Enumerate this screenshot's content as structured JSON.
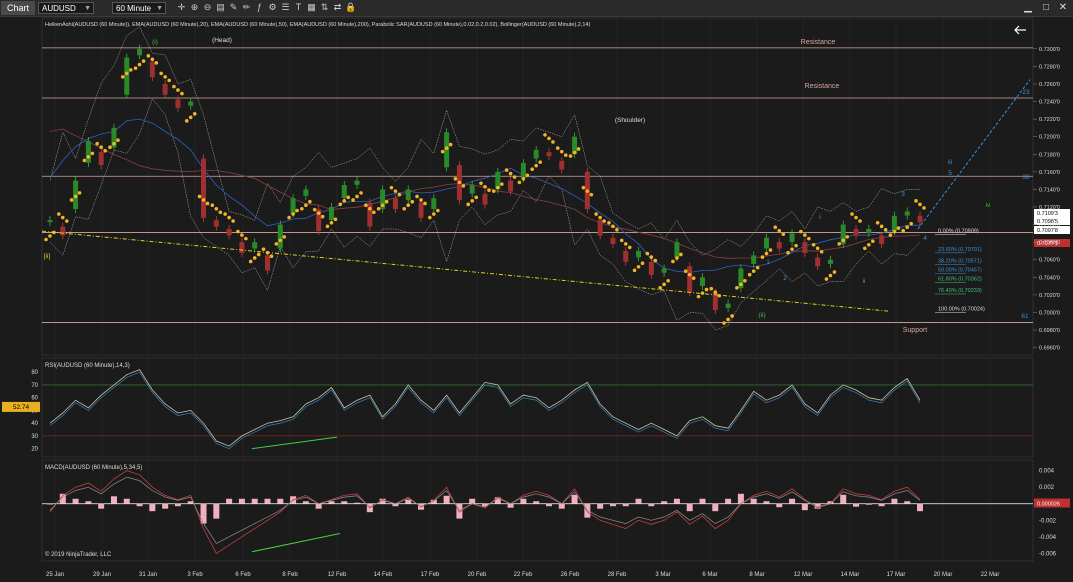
{
  "toolbar": {
    "chart_tab": "Chart",
    "instrument": "AUDUSD",
    "timeframe": "60 Minute",
    "icons": [
      "crosshair-icon",
      "zoom-in-icon",
      "zoom-out-icon",
      "bar-type-icon",
      "style-icon",
      "pencil-icon",
      "indicators-icon",
      "strategy-icon",
      "properties-icon",
      "text-icon",
      "datatable-icon",
      "chart-trader-icon",
      "shared-icon",
      "lock-icon"
    ]
  },
  "indicators_line": "HeikenAshi(AUDUSD (60 Minute)), EMA(AUDUSD (60 Minute),20), EMA(AUDUSD (60 Minute),50), EMA(AUDUSD (60 Minute),200), Parabolic SAR(AUDUSD (60 Minute),0.02,0.2,0.02), Bollinger(AUDUSD (60 Minute),2,14)",
  "rsi_title": "RSI(AUDUSD (60 Minute),14,3)",
  "macd_title": "MACD(AUDUSD (60 Minute),5,34,5)",
  "copyright": "© 2019 NinjaTrader, LLC",
  "colors": {
    "background": "#1b1b1b",
    "sar": "#f0b428",
    "resistance": "#d8a8a0",
    "trend": "#e0d020",
    "fib_blue": "#3a90d8",
    "fib_green": "#40c080"
  },
  "chart_data": [
    {
      "type": "line",
      "panel": "price",
      "x_ticks": [
        "25 Jan",
        "29 Jan",
        "31 Jan",
        "3 Feb",
        "6 Feb",
        "8 Feb",
        "12 Feb",
        "14 Feb",
        "17 Feb",
        "20 Feb",
        "22 Feb",
        "26 Feb",
        "28 Feb",
        "3 Mar",
        "6 Mar",
        "8 Mar",
        "12 Mar",
        "14 Mar",
        "17 Mar",
        "20 Mar",
        "22 Mar"
      ],
      "y_ticks": [
        "0.7300'0",
        "0.7280'0",
        "0.7260'0",
        "0.7240'0",
        "0.7220'0",
        "0.7200'0",
        "0.7180'0",
        "0.7160'0",
        "0.7140'0",
        "0.7120'0",
        "0.7100'0",
        "0.7080'0",
        "0.7060'0",
        "0.7040'0",
        "0.7020'0",
        "0.7000'0",
        "0.6980'0",
        "0.6960'0"
      ],
      "ylim": [
        0.6955,
        0.731
      ],
      "series": [
        {
          "name": "HeikenAshi(AUDUSD (60 Minute))",
          "values": [
            0.7105,
            0.709,
            0.715,
            0.7195,
            0.717,
            0.721,
            0.729,
            0.73,
            0.727,
            0.725,
            0.7235,
            0.724,
            0.711,
            0.71,
            0.709,
            0.707,
            0.708,
            0.705,
            0.71,
            0.713,
            0.714,
            0.7095,
            0.712,
            0.7145,
            0.715,
            0.71,
            0.714,
            0.712,
            0.714,
            0.711,
            0.713,
            0.7205,
            0.713,
            0.7145,
            0.7125,
            0.716,
            0.714,
            0.717,
            0.7185,
            0.718,
            0.7165,
            0.72,
            0.712,
            0.709,
            0.708,
            0.706,
            0.707,
            0.7045,
            0.705,
            0.708,
            0.7025,
            0.704,
            0.7005,
            0.701,
            0.705,
            0.7065,
            0.7085,
            0.7075,
            0.709,
            0.707,
            0.7055,
            0.706,
            0.71,
            0.709,
            0.7095,
            0.708,
            0.711,
            0.7115,
            0.7105
          ]
        }
      ],
      "price_markers": [
        "0.7109'3",
        "0.7098'5",
        "0.7097'8",
        "0.7077'1"
      ],
      "levels": [
        {
          "label": "Resistance",
          "value": 0.7301
        },
        {
          "label": "Resistance",
          "value": 0.7244
        },
        {
          "label": "",
          "value": 0.7155
        },
        {
          "label": "",
          "value": 0.70909
        },
        {
          "label": "Support",
          "value": 0.69885
        }
      ],
      "fibonacci": [
        {
          "label": "0.00% (0.70909)",
          "value": 0.70909
        },
        {
          "label": "23.60% (0.70701)",
          "value": 0.70701
        },
        {
          "label": "38.20% (0.70571)",
          "value": 0.70571
        },
        {
          "label": "50.00% (0.70467)",
          "value": 0.70467
        },
        {
          "label": "61.80% (0.70362)",
          "value": 0.70362
        },
        {
          "label": "76.40% (0.70233)",
          "value": 0.70233
        },
        {
          "label": "100.00% (0.70024)",
          "value": 0.70024
        }
      ],
      "annotations": [
        "(i)",
        "(Head)",
        "(Shoulder)",
        "(ii)",
        "[ii]",
        "iii",
        "iv",
        "i",
        "ii",
        "1",
        "2",
        "3",
        "4",
        "5",
        "23",
        "38",
        "61"
      ]
    },
    {
      "type": "line",
      "panel": "rsi",
      "y_ticks": [
        "80",
        "70",
        "60",
        "50",
        "40",
        "30",
        "20"
      ],
      "ylim": [
        15,
        88
      ],
      "current_value": "52.74",
      "levels": [
        70,
        30
      ],
      "series": [
        {
          "name": "RSI(AUDUSD (60 Minute),14,3)",
          "values": [
            40,
            48,
            58,
            52,
            62,
            70,
            78,
            82,
            66,
            55,
            48,
            50,
            40,
            26,
            22,
            30,
            35,
            40,
            42,
            45,
            55,
            60,
            68,
            52,
            58,
            62,
            45,
            55,
            70,
            58,
            50,
            62,
            48,
            60,
            72,
            70,
            55,
            62,
            60,
            52,
            58,
            66,
            72,
            55,
            45,
            40,
            35,
            40,
            35,
            30,
            42,
            45,
            38,
            36,
            50,
            65,
            58,
            62,
            70,
            55,
            48,
            62,
            70,
            66,
            60,
            58,
            68,
            75,
            58
          ]
        }
      ]
    },
    {
      "type": "line",
      "panel": "macd",
      "y_ticks": [
        "0.004",
        "0.002",
        "0.000026",
        "-0.002",
        "-0.004",
        "-0.006"
      ],
      "ylim": [
        -0.0068,
        0.0048
      ],
      "current_value": "0.000026",
      "series": [
        {
          "name": "MACD(AUDUSD (60 Minute),5,34,5)",
          "values": [
            -0.001,
            0.001,
            0.002,
            0.0025,
            0.0015,
            0.003,
            0.004,
            0.0035,
            0.002,
            0.001,
            0.0005,
            0.001,
            -0.003,
            -0.006,
            -0.005,
            -0.004,
            -0.003,
            -0.002,
            -0.001,
            0.0005,
            0.001,
            0.0,
            0.0005,
            0.001,
            0.0012,
            -0.0005,
            0.0005,
            0.0,
            0.0008,
            -0.0004,
            0.0004,
            0.002,
            -0.001,
            0.0,
            -0.0005,
            0.0008,
            0.0,
            0.001,
            0.0015,
            0.001,
            0.0,
            0.0018,
            -0.001,
            -0.002,
            -0.0025,
            -0.003,
            -0.002,
            -0.0025,
            -0.002,
            -0.001,
            -0.0025,
            -0.0015,
            -0.003,
            -0.002,
            0.0,
            0.001,
            0.0015,
            0.0008,
            0.0018,
            0.0005,
            -0.0005,
            0.0,
            0.0018,
            0.0012,
            0.001,
            0.0005,
            0.0015,
            0.002,
            0.0005
          ]
        }
      ]
    }
  ]
}
